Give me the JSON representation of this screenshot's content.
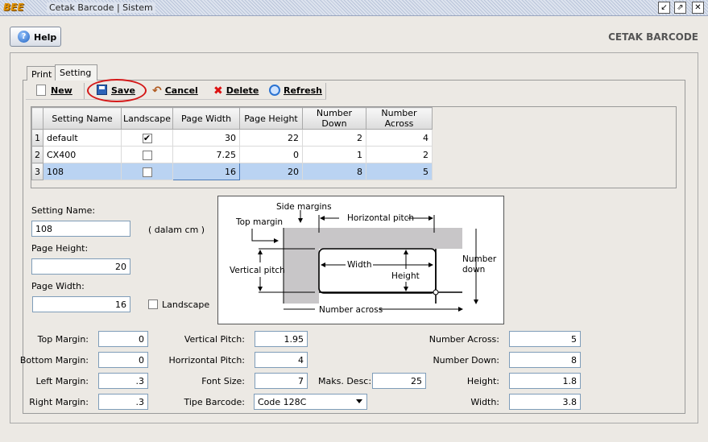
{
  "window": {
    "logo": "BEE",
    "title": "Cetak Barcode | Sistem",
    "buttons": {
      "restore": "↙",
      "maximize": "⇗",
      "close": "✕"
    }
  },
  "header": {
    "help_label": "Help",
    "page_title": "CETAK BARCODE"
  },
  "tabs": [
    {
      "label": "Print"
    },
    {
      "label": "Setting",
      "active": true
    }
  ],
  "toolbar": {
    "new_label": "New",
    "save_label": "Save",
    "cancel_label": "Cancel",
    "delete_label": "Delete",
    "refresh_label": "Refresh"
  },
  "grid": {
    "columns": [
      "Setting Name",
      "Landscape",
      "Page Width",
      "Page Height",
      "Number Down",
      "Number Across"
    ],
    "rows": [
      {
        "n": "1",
        "name": "default",
        "landscape": "✔",
        "width": "30",
        "height": "22",
        "down": "2",
        "across": "4"
      },
      {
        "n": "2",
        "name": "CX400",
        "landscape": "",
        "width": "7.25",
        "height": "0",
        "down": "1",
        "across": "2"
      },
      {
        "n": "3",
        "name": "108",
        "landscape": "",
        "width": "16",
        "height": "20",
        "down": "8",
        "across": "5"
      }
    ]
  },
  "form": {
    "setting_name_label": "Setting Name:",
    "setting_name_value": "108",
    "unit_note": "( dalam cm )",
    "page_height_label": "Page Height:",
    "page_height_value": "20",
    "page_width_label": "Page Width:",
    "page_width_value": "16",
    "landscape_label": "Landscape",
    "top_margin_label": "Top Margin:",
    "top_margin_value": "0",
    "bottom_margin_label": "Bottom Margin:",
    "bottom_margin_value": "0",
    "left_margin_label": "Left Margin:",
    "left_margin_value": ".3",
    "right_margin_label": "Right Margin:",
    "right_margin_value": ".3",
    "vertical_pitch_label": "Vertical Pitch:",
    "vertical_pitch_value": "1.95",
    "horizontal_pitch_label": "Horrizontal Pitch:",
    "horizontal_pitch_value": "4",
    "font_size_label": "Font Size:",
    "font_size_value": "7",
    "maks_desc_label": "Maks. Desc:",
    "maks_desc_value": "25",
    "tipe_barcode_label": "Tipe Barcode:",
    "tipe_barcode_value": "Code 128C",
    "number_across_label": "Number Across:",
    "number_across_value": "5",
    "number_down_label": "Number Down:",
    "number_down_value": "8",
    "height_label": "Height:",
    "height_value": "1.8",
    "width_label": "Width:",
    "width_value": "3.8"
  },
  "diagram": {
    "side_margins": "Side margins",
    "top_margin": "Top margin",
    "horizontal_pitch": "Horizontal pitch",
    "vertical_pitch": "Vertical pitch",
    "width": "Width",
    "height": "Height",
    "number_down_1": "Number",
    "number_down_2": "down",
    "number_across": "Number across"
  },
  "colors": {
    "selected_row": "#bad3f2",
    "highlight_ring": "#d41818",
    "diagram_shade": "#c8c6c8"
  }
}
